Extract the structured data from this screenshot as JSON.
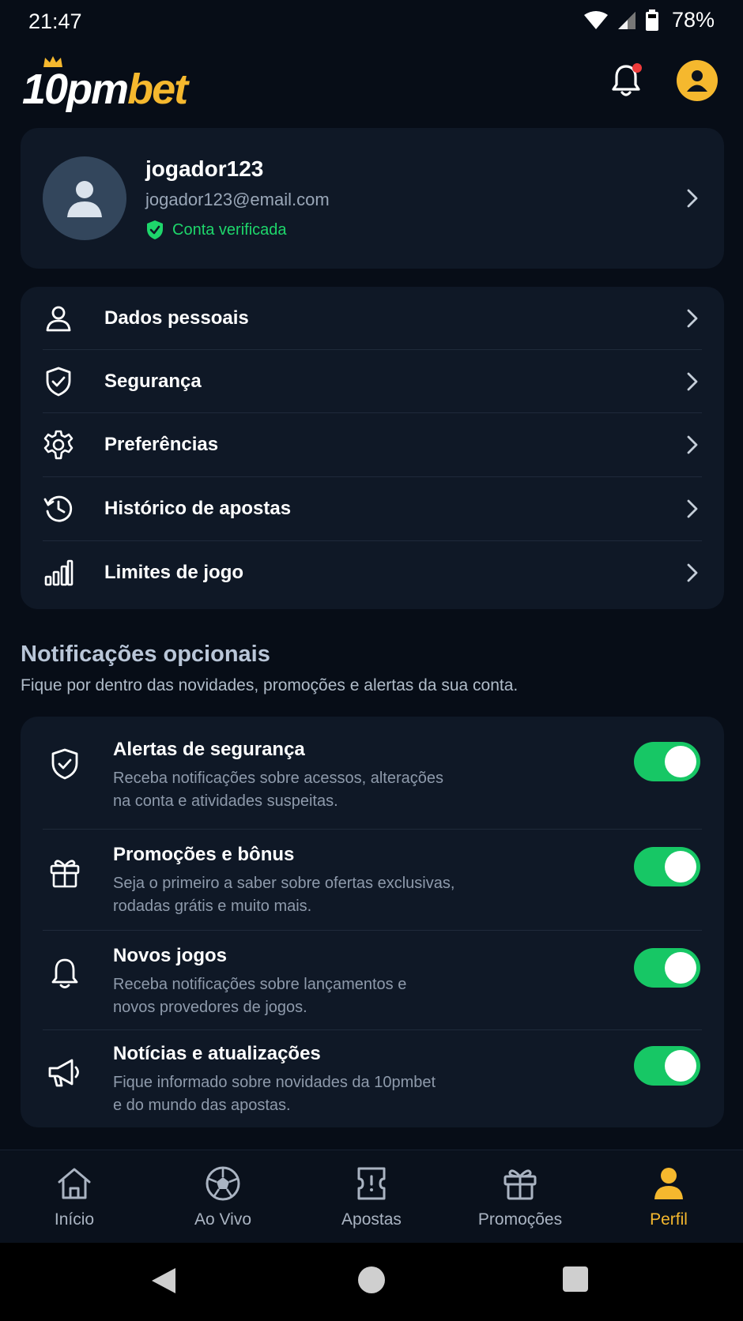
{
  "status": {
    "time": "21:47",
    "battery": "78%"
  },
  "app": {
    "logo_part1": "10pm",
    "logo_part2": "bet",
    "brand_color": "#f5b82e"
  },
  "profile": {
    "username": "jogador123",
    "email": "jogador123@email.com",
    "verified": "Conta verificada"
  },
  "menu": {
    "items": [
      {
        "label": "Dados pessoais",
        "icon": "person-icon"
      },
      {
        "label": "Segurança",
        "icon": "shield-check-icon"
      },
      {
        "label": "Preferências",
        "icon": "gear-icon"
      },
      {
        "label": "Histórico de apostas",
        "icon": "history-icon"
      },
      {
        "label": "Limites de jogo",
        "icon": "bar-chart-icon"
      }
    ]
  },
  "notifications": {
    "title": "Notificações opcionais",
    "subtitle": "Fique por dentro das novidades, promoções e alertas da sua conta.",
    "items": [
      {
        "title": "Alertas de segurança",
        "desc1": "Receba notificações sobre acessos, alterações",
        "desc2": "na conta e atividades suspeitas.",
        "enabled": true,
        "icon": "shield-check-icon"
      },
      {
        "title": "Promoções e bônus",
        "desc1": "Seja o primeiro a saber sobre ofertas exclusivas,",
        "desc2": "rodadas grátis e muito mais.",
        "enabled": true,
        "icon": "gift-icon"
      },
      {
        "title": "Novos jogos",
        "desc1": "Receba notificações sobre lançamentos e",
        "desc2": "novos provedores de jogos.",
        "enabled": true,
        "icon": "bell-icon"
      },
      {
        "title": "Notícias e atualizações",
        "desc1": "Fique informado sobre novidades da 10pmbet",
        "desc2": "e do mundo das apostas.",
        "enabled": true,
        "icon": "megaphone-icon"
      }
    ]
  },
  "bottom_nav": {
    "items": [
      {
        "label": "Início",
        "icon": "home-icon"
      },
      {
        "label": "Ao Vivo",
        "icon": "soccer-ball-icon"
      },
      {
        "label": "Apostas",
        "icon": "ticket-icon"
      },
      {
        "label": "Promoções",
        "icon": "gift-icon"
      },
      {
        "label": "Perfil",
        "icon": "person-icon",
        "active": true
      }
    ]
  },
  "colors": {
    "toggle_on": "#17c765",
    "verified": "#1ed66b",
    "active_nav": "#f5b82e",
    "background": "#070d17",
    "card": "#0f1826"
  }
}
